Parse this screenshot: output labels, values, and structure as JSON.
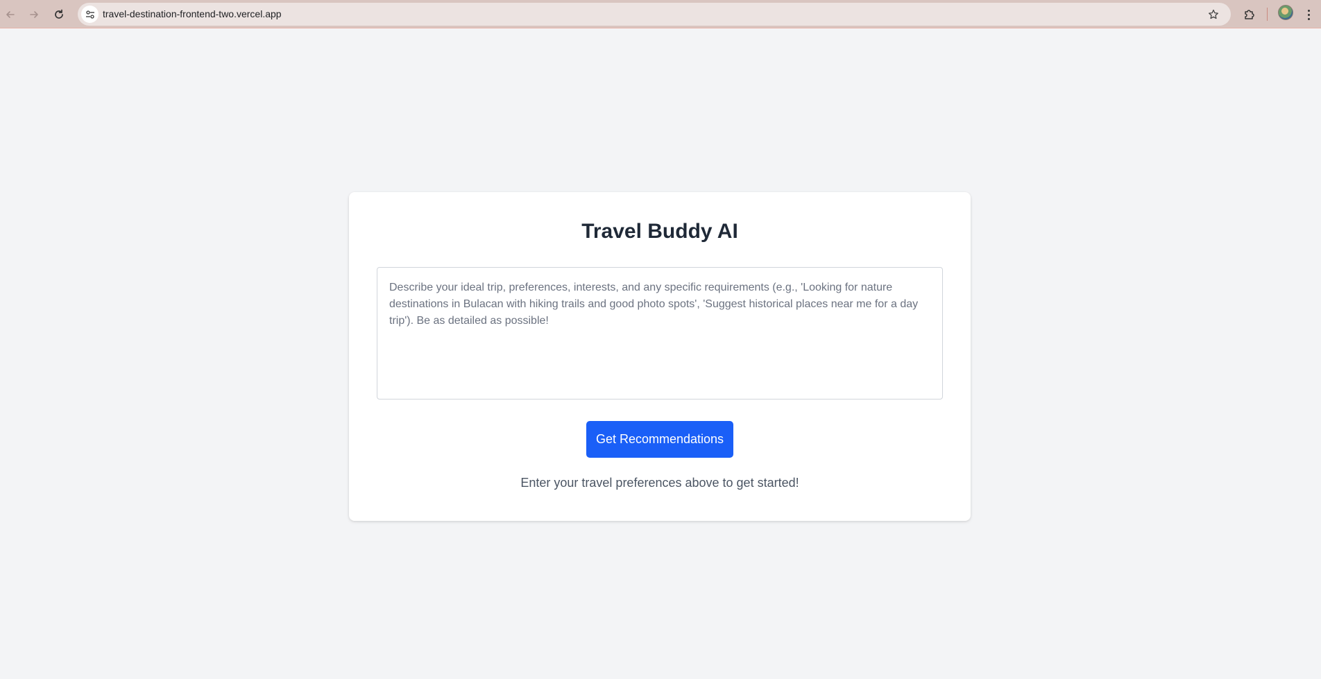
{
  "browser": {
    "url": "travel-destination-frontend-two.vercel.app",
    "icons": {
      "back": "arrow-left-icon",
      "forward": "arrow-right-icon",
      "reload": "reload-icon",
      "site_info": "tune-icon",
      "bookmark": "star-icon",
      "extensions": "puzzle-icon",
      "menu": "more-vertical-icon"
    }
  },
  "app": {
    "title": "Travel Buddy AI",
    "prompt": {
      "value": "",
      "placeholder": "Describe your ideal trip, preferences, interests, and any specific requirements (e.g., 'Looking for nature destinations in Bulacan with hiking trails and good photo spots', 'Suggest historical places near me for a day trip'). Be as detailed as possible!"
    },
    "submit_label": "Get Recommendations",
    "hint": "Enter your travel preferences above to get started!"
  },
  "colors": {
    "page_background": "#f3f4f6",
    "accent_button": "#1a5ff7",
    "title_text": "#1f2937",
    "browser_bar": "#d9c5c0"
  }
}
